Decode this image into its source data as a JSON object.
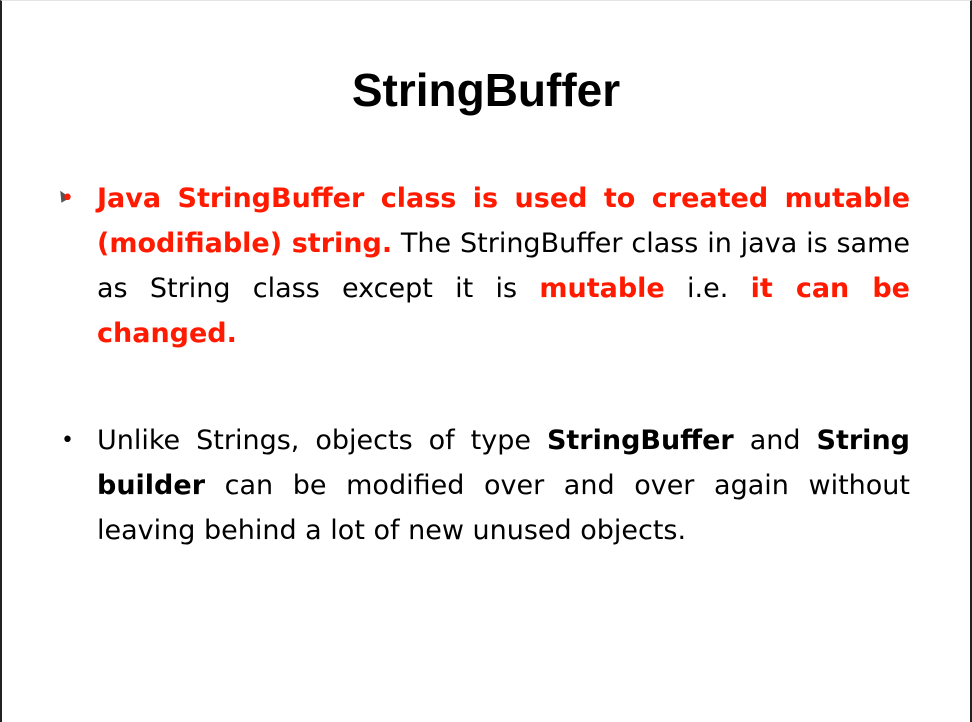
{
  "slide": {
    "title": "StringBuffer",
    "bullet1": {
      "red_lead": "Java StringBuffer class is used to created mutable (modifiable) string.",
      "text1": " The StringBuffer class in java is same as String class except it is ",
      "red_mutable": "mutable",
      "text2": " i.e. ",
      "red_end": "it can be changed."
    },
    "bullet2": {
      "text1": "Unlike Strings, objects of type ",
      "bold1": "StringBuffer",
      "text2": " and ",
      "bold2": "String builder",
      "text3": " can be modified over and over again without leaving behind a lot of new unused objects."
    },
    "bullet_glyph": "•"
  }
}
